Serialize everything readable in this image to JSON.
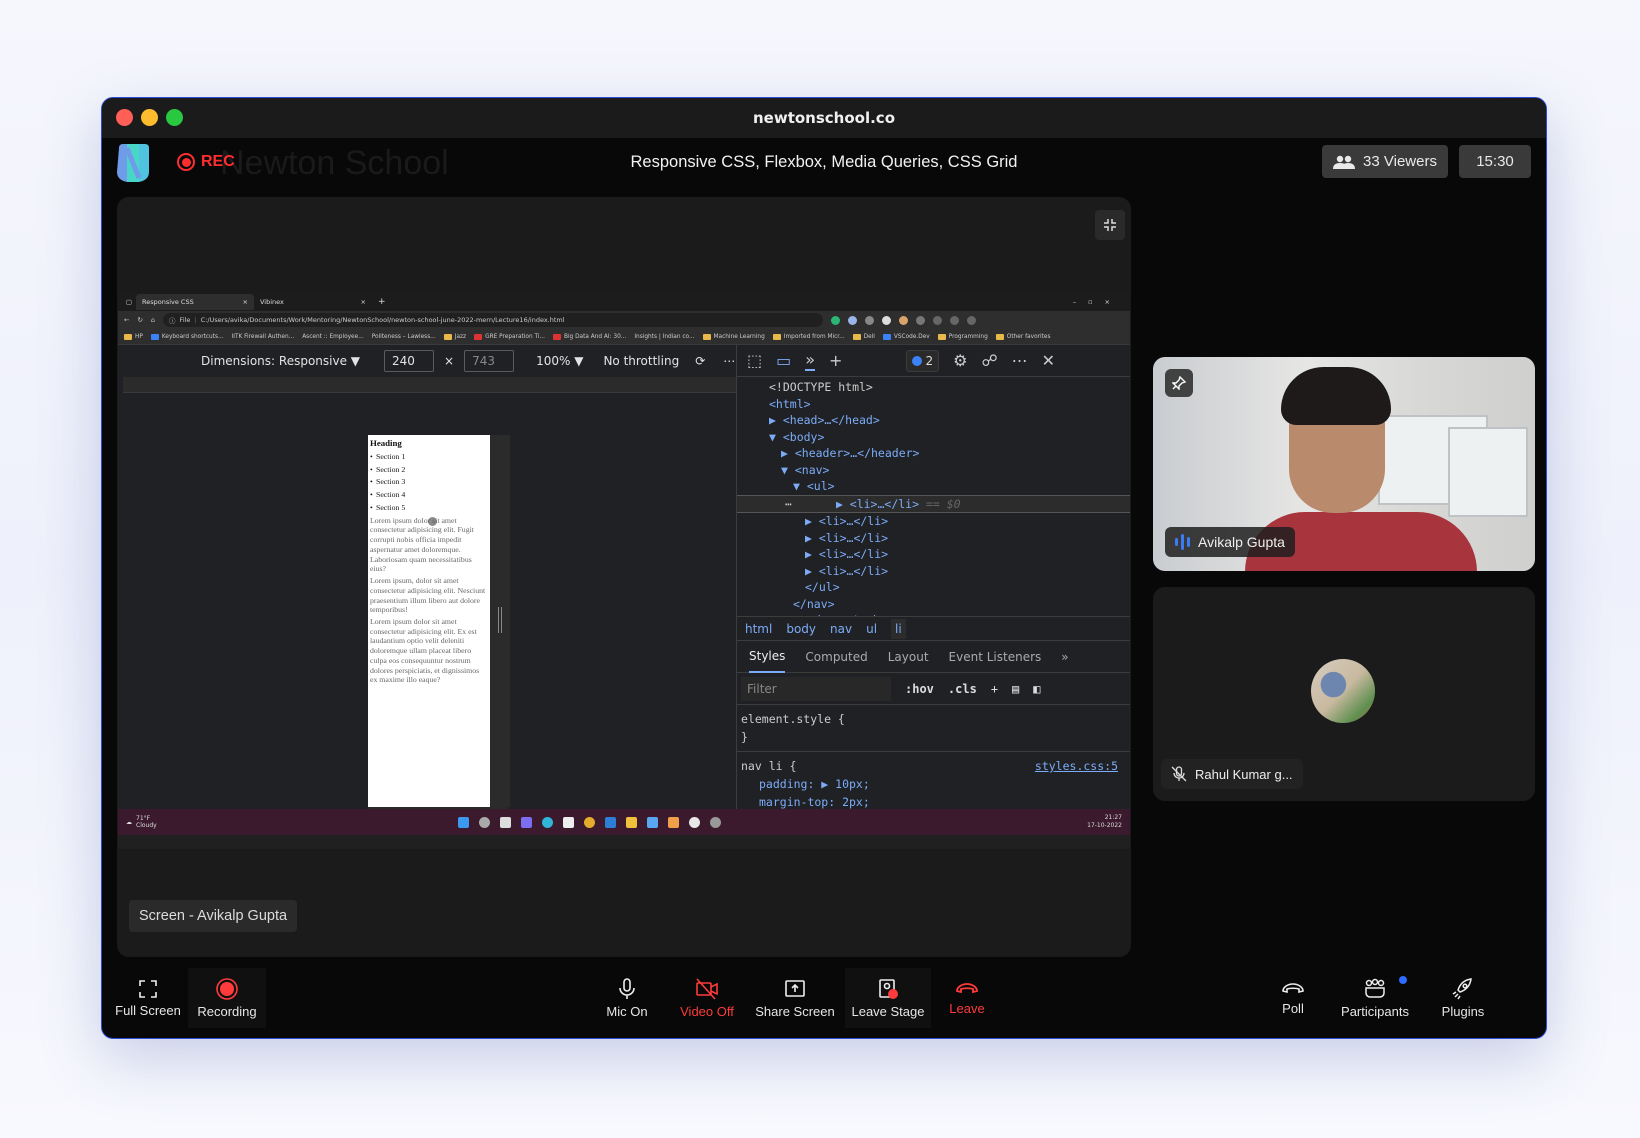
{
  "window": {
    "title": "newtonschool.co"
  },
  "header": {
    "brand_ghost": "Newton School",
    "rec_label": "REC",
    "session_title": "Responsive CSS, Flexbox, Media Queries, CSS Grid",
    "viewers": "33 Viewers",
    "clock": "15:30"
  },
  "colors": {
    "accent": "#3b7cf6",
    "record": "#ff2e2e",
    "taskbar": "#3a1a2c"
  },
  "shared_screen": {
    "label": "Screen - Avikalp Gupta",
    "browser": {
      "tabs": [
        {
          "title": "Responsive CSS",
          "close": "×"
        },
        {
          "title": "Vibinex",
          "close": "×"
        }
      ],
      "new_tab": "+",
      "url_prefix": "File",
      "url": "C:/Users/avika/Documents/Work/Mentoring/NewtonSchool/newton-school-june-2022-mern/Lecture16/index.html",
      "bookmarks": [
        "HP",
        "Keyboard shortcuts...",
        "IITK Firewall Authen...",
        "Ascent :: Employee...",
        "Politeness – Lawless...",
        "Jazz",
        "GRE Preparation Ti...",
        "Big Data And AI: 30...",
        "Insights | Indian co...",
        "Machine Learning",
        "Imported from Micr...",
        "Dell",
        "VSCode.Dev",
        "Programming"
      ],
      "other_favorites": "Other favorites"
    },
    "device_toolbar": {
      "dimensions": "Dimensions: Responsive",
      "width": "240",
      "times": "×",
      "height": "743",
      "zoom": "100%",
      "throttling": "No throttling",
      "more": "⋯"
    },
    "page": {
      "heading": "Heading",
      "sections": [
        "Section 1",
        "Section 2",
        "Section 3",
        "Section 4",
        "Section 5"
      ],
      "paragraphs": [
        "Lorem ipsum dolor sit amet consectetur adipisicing elit. Fugit corrupti nobis officia impedit aspernatur amet doloremque. Laboriosam quam necessitatibus eius?",
        "Lorem ipsum, dolor sit amet consectetur adipisicing elit. Nesciunt praesentium illum libero aut dolore temporibus!",
        "Lorem ipsum dolor sit amet consectetur adipisicing elit. Ex est laudantium optio velit deleniti doloremque ullam placeat libero culpa eos consequuntur nostrum dolores perspiciatis, et dignissimos ex maxime illo eaque?"
      ]
    },
    "devtools": {
      "issues_count": "2",
      "dom": [
        {
          "text": "<!DOCTYPE html>",
          "indent": 1,
          "cls": "gray"
        },
        {
          "text": "<html>",
          "indent": 1
        },
        {
          "text": "▶ <head>…</head>",
          "indent": 1
        },
        {
          "text": "▼ <body>",
          "indent": 1
        },
        {
          "text": "▶ <header>…</header>",
          "indent": 2
        },
        {
          "text": "▼ <nav>",
          "indent": 2
        },
        {
          "text": "▼ <ul>",
          "indent": 3
        },
        {
          "text": "▶ <li>…</li>",
          "indent": 4,
          "selected": true,
          "suffix": " == $0"
        },
        {
          "text": "▶ <li>…</li>",
          "indent": 4
        },
        {
          "text": "▶ <li>…</li>",
          "indent": 4
        },
        {
          "text": "▶ <li>…</li>",
          "indent": 4
        },
        {
          "text": "▶ <li>…</li>",
          "indent": 4
        },
        {
          "text": "</ul>",
          "indent": 4
        },
        {
          "text": "</nav>",
          "indent": 3
        },
        {
          "text": "▶ <main>…</main>",
          "indent": 2
        }
      ],
      "breadcrumbs": [
        "html",
        "body",
        "nav",
        "ul",
        "li"
      ],
      "style_tabs": [
        "Styles",
        "Computed",
        "Layout",
        "Event Listeners"
      ],
      "filter_placeholder": "Filter",
      "hov": ":hov",
      "cls": ".cls",
      "element_style_open": "element.style {",
      "close_brace": "}",
      "rule_selector": "nav li {",
      "rule_source": "styles.css:5",
      "rule_props": [
        "padding: ▶ 10px;",
        "margin-top: 2px;"
      ]
    },
    "taskbar": {
      "temp": "71°F",
      "weather": "Cloudy",
      "time": "21:27",
      "date": "17-10-2022"
    }
  },
  "participants": [
    {
      "name": "Avikalp Gupta",
      "video": true,
      "speaking": true
    },
    {
      "name": "Rahul Kumar g...",
      "video": false,
      "muted": true
    }
  ],
  "toolbar": {
    "full_screen": "Full Screen",
    "recording": "Recording",
    "mic": "Mic On",
    "video": "Video Off",
    "share": "Share Screen",
    "leave_stage": "Leave Stage",
    "leave": "Leave",
    "poll": "Poll",
    "participants": "Participants",
    "plugins": "Plugins"
  }
}
